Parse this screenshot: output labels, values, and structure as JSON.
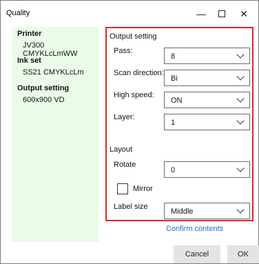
{
  "window": {
    "title": "Quality",
    "minimize_glyph": "—",
    "close_glyph": "✕"
  },
  "summary": {
    "printer_heading": "Printer",
    "printer_value": "JV300 CMYKLcLmWW",
    "inkset_heading": "Ink set",
    "inkset_value": "SS21 CMYKLcLm",
    "output_heading": "Output setting",
    "output_value": "600x900 VD"
  },
  "output_setting": {
    "section_title": "Output setting",
    "pass": {
      "label": "Pass:",
      "value": "8"
    },
    "scan_direction": {
      "label": "Scan direction:",
      "value": "Bi"
    },
    "high_speed": {
      "label": "High speed:",
      "value": "ON"
    },
    "layer": {
      "label": "Layer:",
      "value": "1"
    }
  },
  "layout": {
    "section_title": "Layout",
    "rotate": {
      "label": "Rotate",
      "value": "0"
    },
    "mirror": {
      "label": "Mirror",
      "checked": false
    },
    "label_size": {
      "label": "Label size",
      "value": "Middle"
    }
  },
  "footer": {
    "confirm_link": "Confirm contents",
    "cancel_label": "Cancel",
    "ok_label": "OK"
  },
  "colors": {
    "highlight_border": "#e8232a",
    "summary_bg": "#eafbe8",
    "link": "#1a6fd0"
  }
}
